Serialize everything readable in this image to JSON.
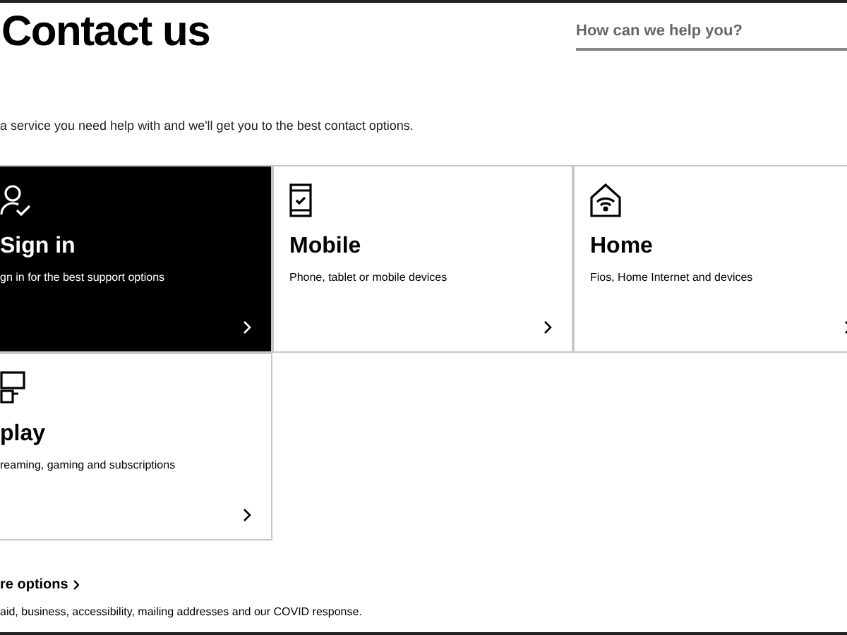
{
  "title": "Contact us",
  "search": {
    "placeholder": "How can we help you?"
  },
  "intro": "a service you need help with and we'll get you to the best contact options.",
  "cards": [
    {
      "kind": "signin",
      "title": "Sign in",
      "subtitle": "gn in for the best support options",
      "selected": true
    },
    {
      "kind": "mobile",
      "title": "Mobile",
      "subtitle": "Phone, tablet or mobile devices",
      "selected": false
    },
    {
      "kind": "home",
      "title": "Home",
      "subtitle": "Fios, Home Internet and devices",
      "selected": false
    },
    {
      "kind": "play",
      "title": "play",
      "subtitle": "reaming, gaming and subscriptions",
      "selected": false
    }
  ],
  "more": {
    "link": "re options",
    "text": "aid, business, accessibility, mailing addresses and our COVID response."
  }
}
